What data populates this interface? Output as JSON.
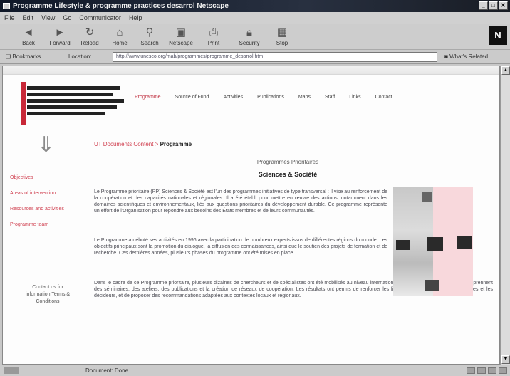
{
  "window": {
    "title": "Programme Lifestyle & programme practices desarrol  Netscape",
    "min_glyph": "_",
    "max_glyph": "□",
    "close_glyph": "✕"
  },
  "menu": [
    "File",
    "Edit",
    "View",
    "Go",
    "Communicator",
    "Help"
  ],
  "toolbar": {
    "back": "Back",
    "forward": "Forward",
    "reload": "Reload",
    "home": "Home",
    "search": "Search",
    "netscape": "Netscape",
    "print": "Print",
    "security": "Security",
    "stop": "Stop",
    "throbber": "N"
  },
  "location": {
    "bookmarks_label": "Bookmarks",
    "location_label": "Location:",
    "url": "http://www.unesco.org/mab/programmes/programme_desarrol.htm",
    "related_label": "What's Related"
  },
  "page": {
    "nav": [
      "Programme",
      "Source of Fund",
      "Activities",
      "Publications",
      "Maps",
      "Staff",
      "Links",
      "Contact"
    ],
    "leftnav": [
      "Objectives",
      "Areas of intervention",
      "Resources and activities",
      "Programme team"
    ],
    "contact_text": "Contact us for information Terms & Conditions",
    "breadcrumb_prefix": "UT Documents Content > ",
    "breadcrumb_current": "Programme",
    "subtitle": "Programmes Prioritaires",
    "heading": "Sciences & Société",
    "paragraphs": [
      "Le Programme prioritaire (PP) Sciences & Société est l'un des programmes initiatives de type transversal : il vise au renforcement de la coopération et des capacités nationales et régionales. Il a été établi pour mettre en œuvre des actions, notamment dans les domaines scientifiques et environnementaux, liés aux questions prioritaires du développement durable. Ce programme représente un effort de l'Organisation pour répondre aux besoins des États membres et de leurs communautés.",
      "Le Programme a débuté ses activités en 1996 avec la participation de nombreux experts issus de différentes régions du monde. Les objectifs principaux sont la promotion du dialogue, la diffusion des connaissances, ainsi que le soutien des projets de formation et de recherche. Ces dernières années, plusieurs phases du programme ont été mises en place.",
      "Dans le cadre de ce Programme prioritaire, plusieurs dizaines de chercheurs et de spécialistes ont été mobilisés au niveau international. Les activités du programme comprennent des séminaires, des ateliers, des publications et la création de réseaux de coopération. Les résultats ont permis de renforcer les liens entre les institutions scientifiques et les décideurs, et de proposer des recommandations adaptées aux contextes locaux et régionaux."
    ]
  },
  "status": {
    "text": "Document: Done"
  },
  "colors": {
    "accent": "#d04050",
    "title_bar": "#1a2233"
  }
}
